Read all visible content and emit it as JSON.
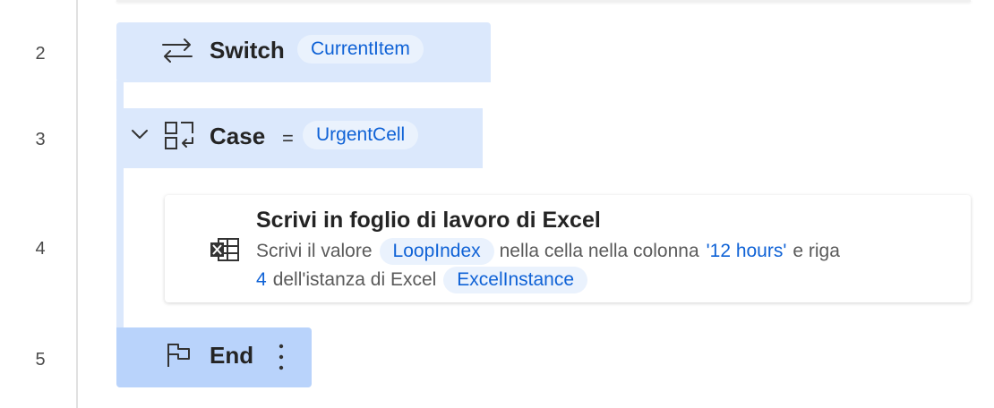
{
  "line_numbers": [
    "2",
    "3",
    "4",
    "5"
  ],
  "switch": {
    "keyword": "Switch",
    "variable": "CurrentItem"
  },
  "case": {
    "keyword": "Case",
    "operator": "=",
    "variable": "UrgentCell"
  },
  "action": {
    "title": "Scrivi in foglio di lavoro di Excel",
    "desc_part1": "Scrivi il valore",
    "value_var": "LoopIndex",
    "desc_part2": "nella cella nella colonna",
    "column_literal": "'12 hours'",
    "desc_part3": "e riga",
    "row_literal": "4",
    "desc_part4": "dell'istanza di Excel",
    "instance_var": "ExcelInstance"
  },
  "end": {
    "keyword": "End"
  },
  "icons": {
    "switch": "switch-arrows-icon",
    "case": "case-icon",
    "collapse": "chevron-down-icon",
    "excel": "excel-write-icon",
    "end": "flag-icon",
    "more": "more-vertical-icon"
  },
  "colors": {
    "block_bg": "#dbe8fc",
    "end_bg": "#b9d3fb",
    "token_bg": "#eaf2fd",
    "token_text": "#0f62d6"
  }
}
